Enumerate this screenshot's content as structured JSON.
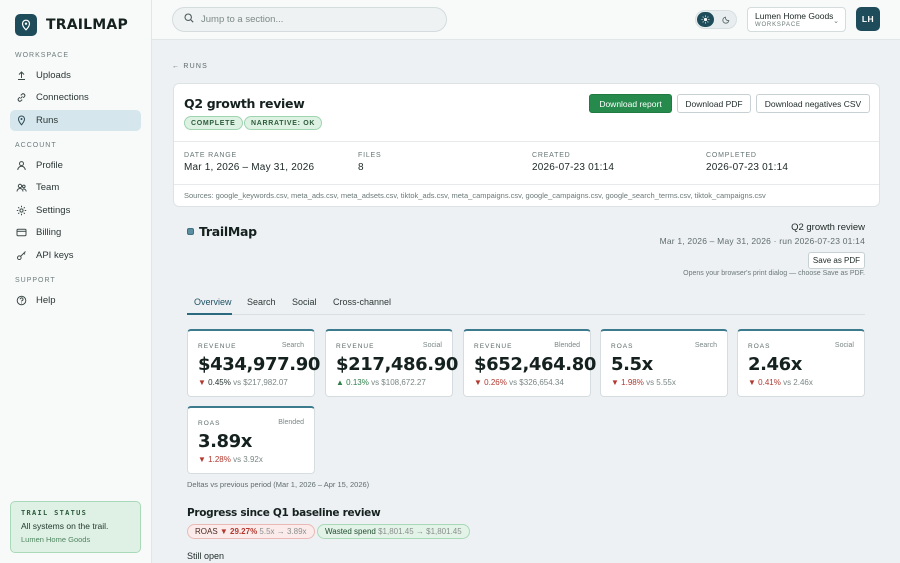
{
  "brand": {
    "name": "TRAILMAP"
  },
  "sidebar": {
    "sections": [
      {
        "label": "WORKSPACE"
      },
      {
        "label": "ACCOUNT"
      },
      {
        "label": "SUPPORT"
      }
    ],
    "items": [
      {
        "label": "Uploads",
        "icon": "upload-icon"
      },
      {
        "label": "Connections",
        "icon": "link-icon"
      },
      {
        "label": "Runs",
        "icon": "pin-icon",
        "active": true
      },
      {
        "label": "Profile",
        "icon": "user-icon"
      },
      {
        "label": "Team",
        "icon": "team-icon"
      },
      {
        "label": "Settings",
        "icon": "gear-icon"
      },
      {
        "label": "Billing",
        "icon": "card-icon"
      },
      {
        "label": "API keys",
        "icon": "key-icon"
      },
      {
        "label": "Help",
        "icon": "help-icon"
      }
    ],
    "trail_status": {
      "title": "TRAIL STATUS",
      "line": "All systems on the trail.",
      "sub": "Lumen Home Goods"
    }
  },
  "topbar": {
    "search_placeholder": "Jump to a section...",
    "workspace_name": "Lumen Home Goods",
    "workspace_label": "WORKSPACE",
    "avatar_initials": "LH"
  },
  "back_link": "← RUNS",
  "run": {
    "title": "Q2 growth review",
    "badges": [
      "COMPLETE",
      "NARRATIVE: OK"
    ],
    "buttons": {
      "download_report": "Download report",
      "download_pdf": "Download PDF",
      "download_negatives": "Download negatives CSV"
    },
    "meta": [
      {
        "label": "DATE RANGE",
        "value": "Mar 1, 2026 – May 31, 2026"
      },
      {
        "label": "FILES",
        "value": "8"
      },
      {
        "label": "CREATED",
        "value": "2026-07-23 01:14"
      },
      {
        "label": "COMPLETED",
        "value": "2026-07-23 01:14"
      }
    ],
    "sources": "Sources: google_keywords.csv, meta_ads.csv, meta_adsets.csv, tiktok_ads.csv, meta_campaigns.csv, google_campaigns.csv, google_search_terms.csv, tiktok_campaigns.csv"
  },
  "report": {
    "brand": "TrailMap",
    "title": "Q2 growth review",
    "subtitle": "Mar 1, 2026 – May 31, 2026 · run 2026-07-23 01:14",
    "save_pdf": "Save as PDF",
    "print_note": "Opens your browser's print dialog — choose Save as PDF.",
    "tabs": [
      "Overview",
      "Search",
      "Social",
      "Cross-channel"
    ],
    "kpis": [
      {
        "label": "REVENUE",
        "channel": "Search",
        "value": "$434,977.90",
        "arrow": "▼",
        "pct": "0.45%",
        "dir": "down",
        "vs": "vs $217,982.07"
      },
      {
        "label": "REVENUE",
        "channel": "Social",
        "value": "$217,486.90",
        "arrow": "▲",
        "pct": "0.13%",
        "dir": "up",
        "vs": "vs $108,672.27"
      },
      {
        "label": "REVENUE",
        "channel": "Blended",
        "value": "$652,464.80",
        "arrow": "▼",
        "pct": "0.26%",
        "dir": "down",
        "vs": "vs $326,654.34"
      },
      {
        "label": "ROAS",
        "channel": "Search",
        "value": "5.5x",
        "arrow": "▼",
        "pct": "1.98%",
        "dir": "down",
        "vs": "vs 5.55x"
      },
      {
        "label": "ROAS",
        "channel": "Social",
        "value": "2.46x",
        "arrow": "▼",
        "pct": "0.41%",
        "dir": "down",
        "vs": "vs 2.46x"
      },
      {
        "label": "ROAS",
        "channel": "Blended",
        "value": "3.89x",
        "arrow": "▼",
        "pct": "1.28%",
        "dir": "down",
        "vs": "vs 3.92x"
      }
    ],
    "delta_note": "Deltas vs previous period (Mar 1, 2026 – Apr 15, 2026)",
    "progress_title": "Progress since Q1 baseline review",
    "chips": {
      "roas": {
        "label": "ROAS",
        "pct": "▼ 29.27%",
        "change": "5.5x → 3.89x"
      },
      "wasted": {
        "label": "Wasted spend",
        "change": "$1,801.45 → $1,801.45"
      }
    },
    "still_open": "Still open"
  },
  "colors": {
    "brand": "#1e4c5a",
    "primary_button": "#258a4b",
    "down": "#b3382f",
    "up": "#2e7f49"
  }
}
